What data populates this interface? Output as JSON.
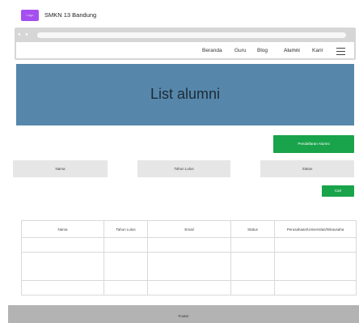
{
  "brand": {
    "logo_text": "Logo",
    "title": "SMKN 13 Bandung"
  },
  "browser": {
    "dots": "● ●"
  },
  "nav": {
    "items": [
      "Beranda",
      "Guru",
      "Blog",
      "Alumni",
      "Karir"
    ],
    "active": "Alumni",
    "menu_icon": "hamburger-icon"
  },
  "hero": {
    "title": "List alumni",
    "background": "#5687ab"
  },
  "actions": {
    "daftar_label": "Pendaftaran Alumni",
    "cari_label": "Cari",
    "accent": "#19a34a"
  },
  "filters": {
    "nama_placeholder": "Nama",
    "tahun_placeholder": "Tahun Lulus",
    "status_placeholder": "Status"
  },
  "table": {
    "headers": [
      "Nama",
      "Tahun Lulus",
      "Email",
      "Status",
      "Perusahaan/Universitas/Wirausaha"
    ],
    "rows": [
      [
        "",
        "",
        "",
        "",
        ""
      ],
      [
        "",
        "",
        "",
        "",
        ""
      ],
      [
        "",
        "",
        "",
        "",
        ""
      ]
    ]
  },
  "footer": {
    "text": "Footer"
  }
}
